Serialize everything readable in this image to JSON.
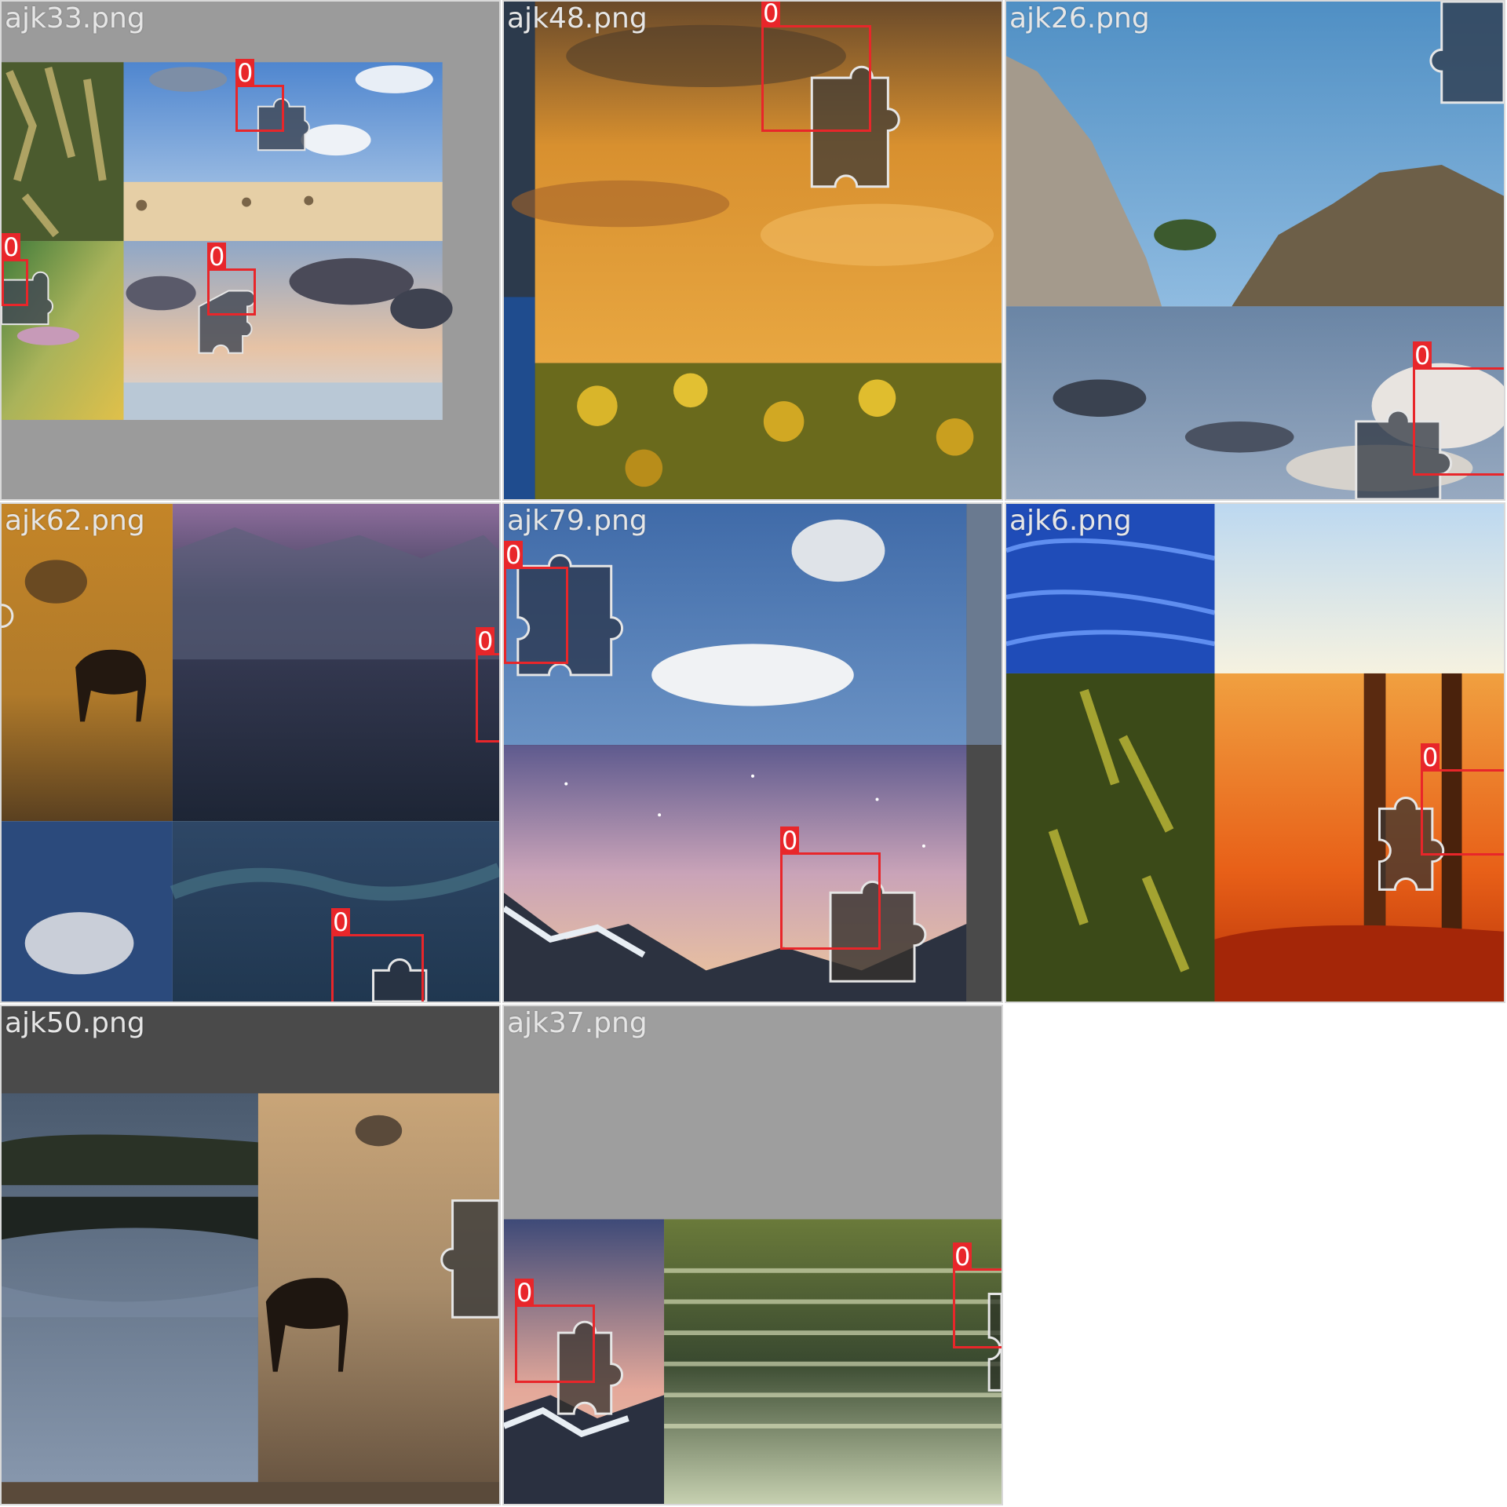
{
  "gallery": {
    "tiles": [
      {
        "filename": "ajk33.png",
        "boxes": [
          {
            "label": "0"
          },
          {
            "label": "0"
          },
          {
            "label": "0"
          }
        ]
      },
      {
        "filename": "ajk48.png",
        "boxes": [
          {
            "label": "0"
          }
        ]
      },
      {
        "filename": "ajk26.png",
        "boxes": [
          {
            "label": "0"
          }
        ]
      },
      {
        "filename": "ajk62.png",
        "boxes": [
          {
            "label": "0"
          },
          {
            "label": "0"
          }
        ]
      },
      {
        "filename": "ajk79.png",
        "boxes": [
          {
            "label": "0"
          },
          {
            "label": "0"
          }
        ]
      },
      {
        "filename": "ajk6.png",
        "boxes": [
          {
            "label": "0"
          }
        ]
      },
      {
        "filename": "ajk50.png",
        "boxes": []
      },
      {
        "filename": "ajk37.png",
        "boxes": [
          {
            "label": "0"
          },
          {
            "label": "0"
          }
        ]
      }
    ]
  },
  "colors": {
    "box": "#e8262a",
    "label_text": "#ffffff",
    "filename_text": "#e6e6e6"
  },
  "icons": [
    "puzzle-piece-icon"
  ]
}
